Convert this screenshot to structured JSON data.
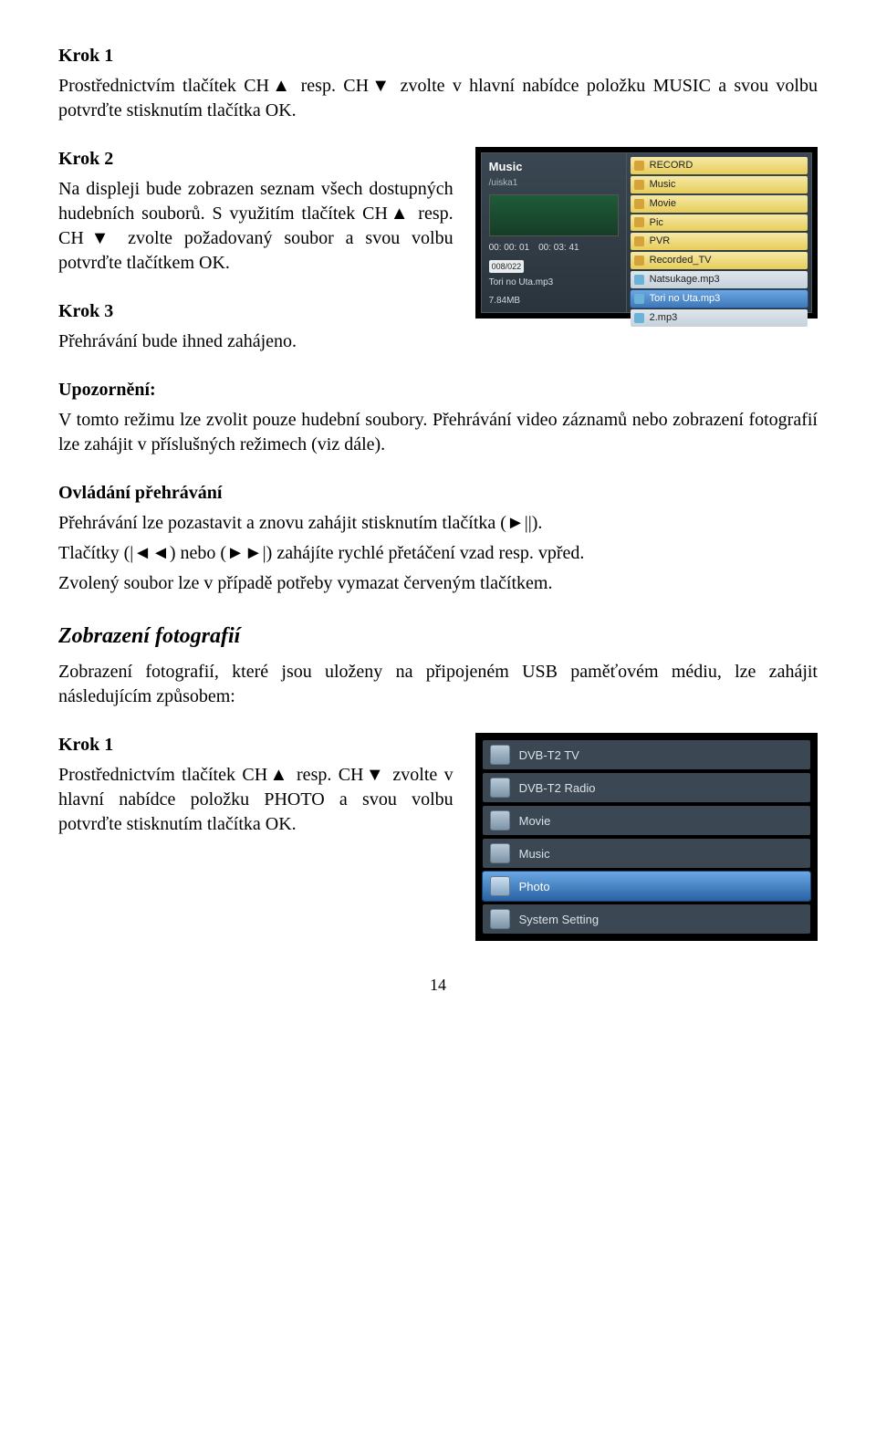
{
  "s1": {
    "h": "Krok 1",
    "p": "Prostřednictvím tlačítek CH▲ resp. CH▼ zvolte v hlavní nabídce položku MUSIC a svou volbu potvrďte stisknutím tlačítka OK."
  },
  "s2": {
    "h": "Krok 2",
    "p": "Na displeji bude zobrazen seznam všech dostupných hudebních souborů. S využitím tlačítek CH▲ resp. CH▼ zvolte požadovaný soubor a svou volbu potvrďte tlačítkem OK."
  },
  "s3": {
    "h": "Krok 3",
    "p": "Přehrávání bude ihned zahájeno."
  },
  "warn": {
    "h": "Upozornění:",
    "p": "V tomto režimu lze zvolit pouze hudební soubory. Přehrávání video záznamů nebo zobrazení fotografií lze zahájit v příslušných režimech (viz dále)."
  },
  "ctrl": {
    "h": "Ovládání přehrávání",
    "p1": "Přehrávání lze pozastavit a znovu zahájit stisknutím tlačítka (►||).",
    "p2": "Tlačítky (|◄◄) nebo (►►|) zahájíte rychlé přetáčení vzad resp. vpřed.",
    "p3": "Zvolený soubor lze v případě potřeby vymazat červeným tlačítkem."
  },
  "phot": {
    "title": "Zobrazení fotografií",
    "intro": "Zobrazení fotografií, které jsou uloženy na připojeném USB paměťovém médiu, lze zahájit následujícím způsobem:"
  },
  "p1": {
    "h": "Krok 1",
    "p": "Prostřednictvím tlačítek CH▲ resp. CH▼ zvolte v hlavní nabídce položku PHOTO a svou volbu potvrďte stisknutím tlačítka OK."
  },
  "shot1": {
    "title": "Music",
    "subtitle": "/uiska1",
    "t1": "00: 00: 01",
    "t2": "00: 03: 41",
    "idx": "008/022",
    "cur": "Tori no Uta.mp3",
    "size": "7.84MB",
    "folders": [
      "RECORD",
      "Music",
      "Movie",
      "Pic",
      "PVR",
      "Recorded_TV"
    ],
    "files": [
      "Natsukage.mp3",
      "Tori no Uta.mp3",
      "2.mp3"
    ],
    "selected": "Tori no Uta.mp3"
  },
  "shot2": {
    "items": [
      "DVB-T2 TV",
      "DVB-T2 Radio",
      "Movie",
      "Music",
      "Photo",
      "System Setting"
    ],
    "selected": "Photo"
  },
  "pagenum": "14"
}
